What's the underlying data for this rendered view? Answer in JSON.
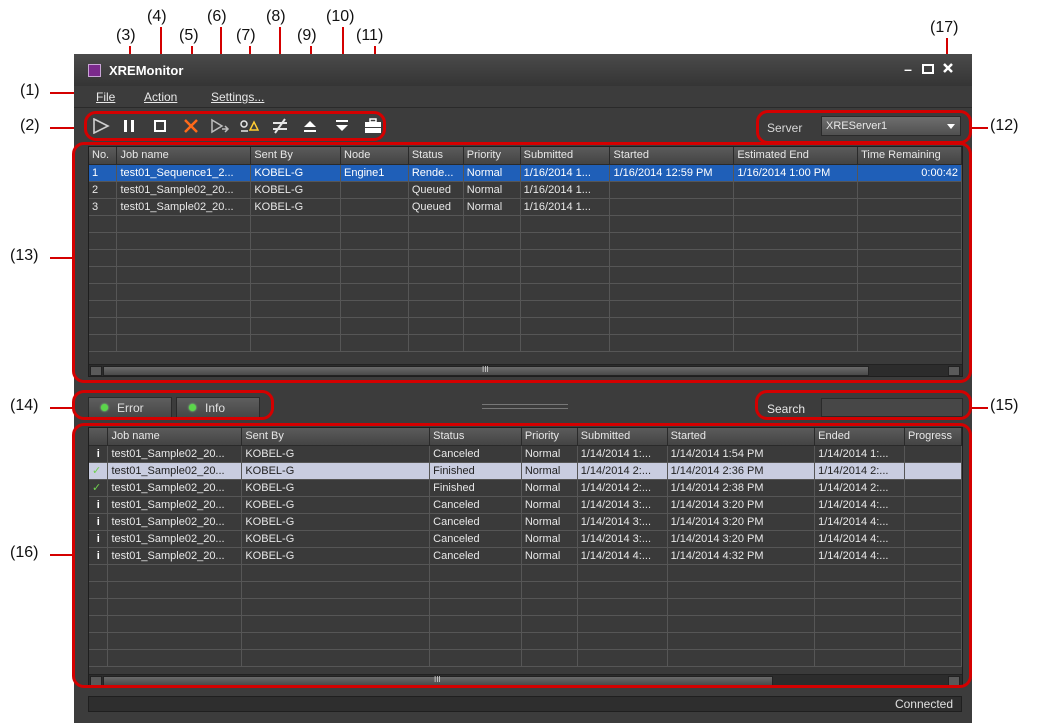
{
  "window": {
    "title": "XREMonitor"
  },
  "menu": {
    "file": "File",
    "action": "Action",
    "settings": "Settings..."
  },
  "toolbar": {
    "buttons": [
      "play-icon",
      "pause-icon",
      "stop-icon",
      "delete-icon",
      "skip-icon",
      "distribute-icon",
      "toggle-icon",
      "move-up-icon",
      "move-down-icon",
      "toolbox-icon"
    ]
  },
  "server": {
    "label": "Server",
    "value": "XREServer1"
  },
  "callouts": [
    "(1)",
    "(2)",
    "(3)",
    "(4)",
    "(5)",
    "(6)",
    "(7)",
    "(8)",
    "(9)",
    "(10)",
    "(11)",
    "(12)",
    "(13)",
    "(14)",
    "(15)",
    "(16)",
    "(17)"
  ],
  "jobs": {
    "headers": [
      "No.",
      "Job name",
      "Sent By",
      "Node",
      "Status",
      "Priority",
      "Submitted",
      "Started",
      "Estimated End",
      "Time Remaining"
    ],
    "rows": [
      [
        "1",
        "test01_Sequence1_2...",
        "KOBEL-G",
        "Engine1",
        "Rende...",
        "Normal",
        "1/16/2014 1...",
        "1/16/2014 12:59 PM",
        "1/16/2014 1:00 PM",
        "0:00:42"
      ],
      [
        "2",
        "test01_Sample02_20...",
        "KOBEL-G",
        "",
        "Queued",
        "Normal",
        "1/16/2014 1...",
        "",
        "",
        ""
      ],
      [
        "3",
        "test01_Sample02_20...",
        "KOBEL-G",
        "",
        "Queued",
        "Normal",
        "1/16/2014 1...",
        "",
        "",
        ""
      ]
    ],
    "scroll_marker": "III"
  },
  "tabs": {
    "error": "Error",
    "info": "Info"
  },
  "search": {
    "label": "Search",
    "value": ""
  },
  "history": {
    "headers": [
      "",
      "Job name",
      "Sent By",
      "Status",
      "Priority",
      "Submitted",
      "Started",
      "Ended",
      "Progress"
    ],
    "rows": [
      [
        "i",
        "test01_Sample02_20...",
        "KOBEL-G",
        "Canceled",
        "Normal",
        "1/14/2014 1:...",
        "1/14/2014 1:54 PM",
        "1/14/2014 1:...",
        ""
      ],
      [
        "✓",
        "test01_Sample02_20...",
        "KOBEL-G",
        "Finished",
        "Normal",
        "1/14/2014 2:...",
        "1/14/2014 2:36 PM",
        "1/14/2014 2:...",
        ""
      ],
      [
        "✓",
        "test01_Sample02_20...",
        "KOBEL-G",
        "Finished",
        "Normal",
        "1/14/2014 2:...",
        "1/14/2014 2:38 PM",
        "1/14/2014 2:...",
        ""
      ],
      [
        "i",
        "test01_Sample02_20...",
        "KOBEL-G",
        "Canceled",
        "Normal",
        "1/14/2014 3:...",
        "1/14/2014 3:20 PM",
        "1/14/2014 4:...",
        ""
      ],
      [
        "i",
        "test01_Sample02_20...",
        "KOBEL-G",
        "Canceled",
        "Normal",
        "1/14/2014 3:...",
        "1/14/2014 3:20 PM",
        "1/14/2014 4:...",
        ""
      ],
      [
        "i",
        "test01_Sample02_20...",
        "KOBEL-G",
        "Canceled",
        "Normal",
        "1/14/2014 3:...",
        "1/14/2014 3:20 PM",
        "1/14/2014 4:...",
        ""
      ],
      [
        "i",
        "test01_Sample02_20...",
        "KOBEL-G",
        "Canceled",
        "Normal",
        "1/14/2014 4:...",
        "1/14/2014 4:32 PM",
        "1/14/2014 4:...",
        ""
      ]
    ],
    "scroll_marker": "III"
  },
  "status": {
    "text": "Connected"
  },
  "colors": {
    "callout": "#d40000",
    "selection": "#1f5fb8",
    "highlight": "#c9cde0",
    "led": "#5bd64a"
  }
}
